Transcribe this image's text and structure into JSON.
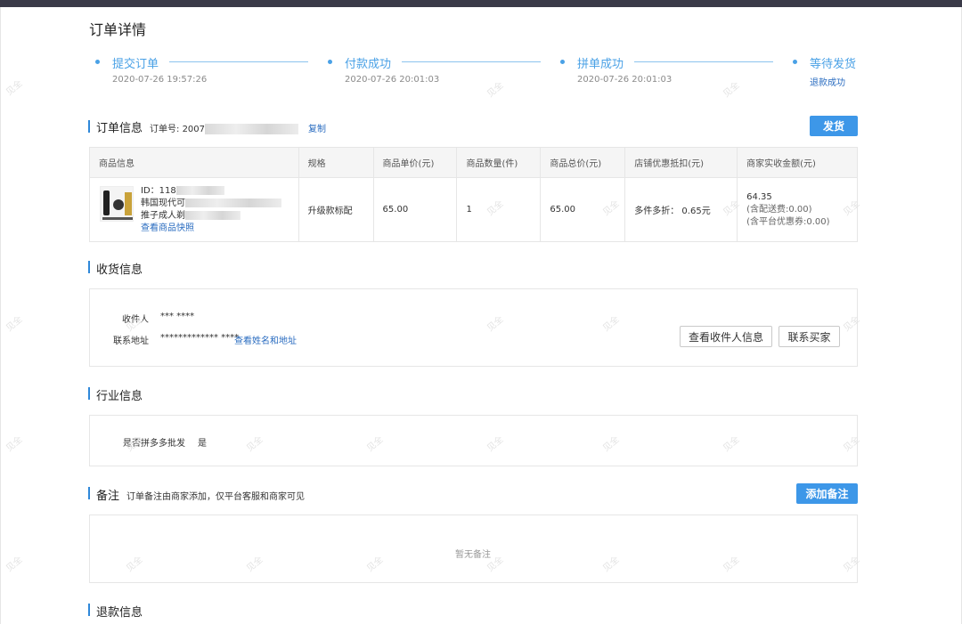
{
  "page": {
    "title": "订单详情"
  },
  "steps": [
    {
      "label": "提交订单",
      "time": "2020-07-26 19:57:26"
    },
    {
      "label": "付款成功",
      "time": "2020-07-26 20:01:03"
    },
    {
      "label": "拼单成功",
      "time": "2020-07-26 20:01:03"
    },
    {
      "label": "等待发货",
      "link": "退款成功"
    }
  ],
  "order_info": {
    "title": "订单信息",
    "order_no_label": "订单号:",
    "order_no_prefix": "2007",
    "copy_label": "复制",
    "ship_button": "发货"
  },
  "table": {
    "headers": [
      "商品信息",
      "规格",
      "商品单价(元)",
      "商品数量(件)",
      "商品总价(元)",
      "店铺优惠抵扣(元)",
      "商家实收金额(元)"
    ],
    "row": {
      "id_label": "ID：118",
      "name_line1": "韩国现代可",
      "name_line2": "推子成人剃",
      "snapshot_link": "查看商品快照",
      "spec": "升级款标配",
      "unit_price": "65.00",
      "quantity": "1",
      "total": "65.00",
      "discount": "多件多折： 0.65元",
      "received": "64.35",
      "received_note1": "(含配送费:0.00)",
      "received_note2": "(含平台优惠券:0.00)"
    }
  },
  "shipping": {
    "title": "收货信息",
    "receiver_label": "收件人",
    "receiver_value": "*** ****",
    "address_label": "联系地址",
    "address_value": "************* ****",
    "view_link": "查看姓名和地址",
    "view_receiver_button": "查看收件人信息",
    "contact_buyer_button": "联系买家"
  },
  "industry": {
    "title": "行业信息",
    "wholesale_label": "是否拼多多批发",
    "wholesale_value": "是"
  },
  "remark": {
    "title": "备注",
    "note": "订单备注由商家添加，仅平台客服和商家可见",
    "add_button": "添加备注",
    "empty": "暂无备注"
  },
  "refund": {
    "title": "退款信息"
  },
  "watermark_text": "见全",
  "colors": {
    "accent": "#3d97e8",
    "link": "#2a6cc0",
    "step": "#4aa1e6"
  }
}
